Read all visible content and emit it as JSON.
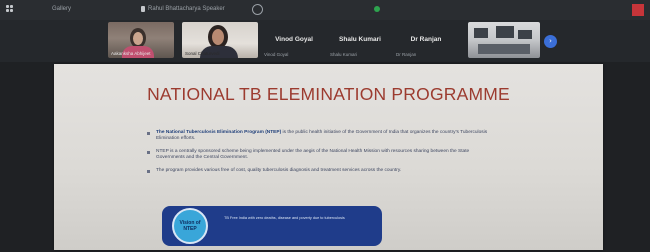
{
  "topbar": {
    "view_label": "Gallery",
    "speaker_label": "Rahul Bhattacharya Speaker"
  },
  "participants": [
    {
      "name": "Aakanksha Abhijeet"
    },
    {
      "name": "Sonal Chaturvedi"
    },
    {
      "name": "Vinod Goyal",
      "caption": "Vinod Goyal"
    },
    {
      "name": "Shalu Kumari",
      "caption": "Shalu Kumari"
    },
    {
      "name": "Dr Ranjan",
      "caption": "Dr Ranjan"
    }
  ],
  "slide": {
    "title": "NATIONAL TB ELEMINATION PROGRAMME",
    "bullets": [
      {
        "lead": "The National Tuberculosis Elimination Program (NTEP)",
        "rest": " is the public health initiative of the Government of India that organizes the country's Tuberculosis Elimination efforts."
      },
      {
        "lead": "",
        "rest": "NTEP is a centrally sponsored scheme being implemented under the aegis of the National Health Mission with resources sharing between the State Governments and the Central Government."
      },
      {
        "lead": "",
        "rest": "The program provides various free of cost, quality tuberculosis diagnosis and treatment services across the country."
      }
    ],
    "vision_label_line1": "Vision of",
    "vision_label_line2": "NTEP",
    "vision_text": "TB Free India with zero deaths, disease and poverty due to tuberculosis"
  },
  "colors": {
    "title": "#9c3b2f",
    "vision_box": "#1f3c8a",
    "vision_circle": "#39a6d9"
  }
}
